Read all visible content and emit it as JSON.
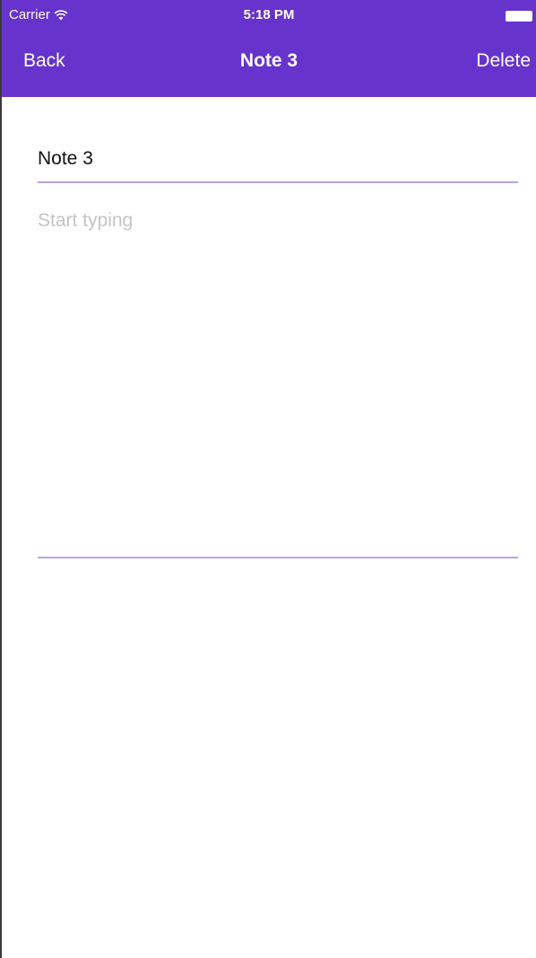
{
  "status_bar": {
    "carrier": "Carrier",
    "wifi_icon": "wifi-icon",
    "time": "5:18 PM",
    "battery_icon": "battery-icon"
  },
  "nav": {
    "back_label": "Back",
    "title": "Note 3",
    "delete_label": "Delete"
  },
  "note": {
    "title_value": "Note 3",
    "body_value": "",
    "body_placeholder": "Start typing"
  },
  "colors": {
    "accent": "#6633cc",
    "field_underline": "#b9a3e8",
    "placeholder": "#c4c4c4"
  }
}
